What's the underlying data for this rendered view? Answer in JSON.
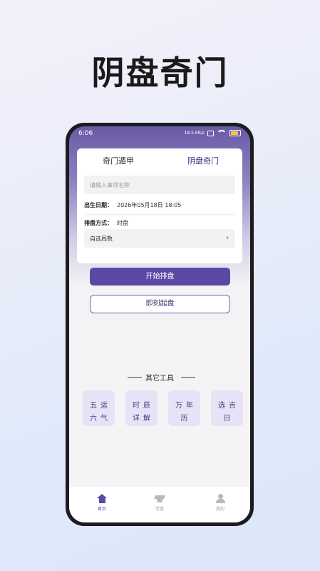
{
  "promo": {
    "headline": "阴盘奇门"
  },
  "status_bar": {
    "time": "6:06",
    "signal_text": "18.5 KB/s"
  },
  "tabs": [
    {
      "label": "奇门遁甲",
      "active": false
    },
    {
      "label": "阴盘奇门",
      "active": true
    }
  ],
  "form": {
    "event_placeholder": "请输入事项名称",
    "birth_label": "出生日期：",
    "birth_value": "2026年05月18日  18:05",
    "method_label": "排盘方式：",
    "method_value": "时盘",
    "select_label": "自选局数",
    "select_chevron": "›"
  },
  "buttons": {
    "start": "开始排盘",
    "instant": "即刻起盘"
  },
  "tools": {
    "title": "其它工具",
    "items": [
      {
        "line1": "五运",
        "line2": "六气"
      },
      {
        "line1": "时辰",
        "line2": "详解"
      },
      {
        "line1": "万年",
        "line2": "历"
      },
      {
        "line1": "选吉",
        "line2": "日"
      }
    ]
  },
  "nav": [
    {
      "label": "首页",
      "icon": "home-icon",
      "active": true
    },
    {
      "label": "学堂",
      "icon": "graduation-cap-icon",
      "active": false
    },
    {
      "label": "我的",
      "icon": "user-icon",
      "active": false
    }
  ],
  "colors": {
    "accent": "#5c48a4",
    "header_gradient_top": "#6a59a7",
    "tool_bg": "#e7e3f6"
  }
}
